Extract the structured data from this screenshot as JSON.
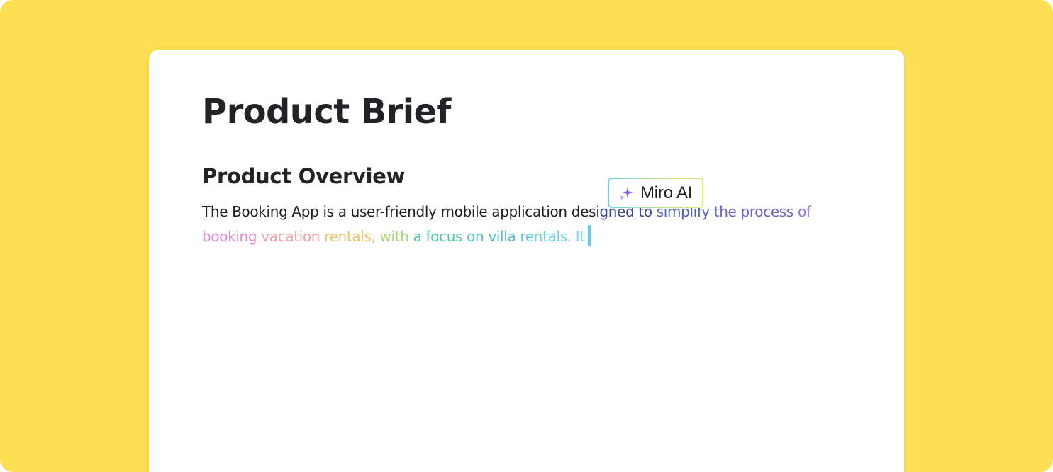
{
  "document": {
    "title": "Product Brief",
    "section_heading": "Product Overview",
    "paragraph_segments": [
      {
        "text": "The Booking App is a user-friendly mobile application des",
        "color": "#1e1f23"
      },
      {
        "text": "igned to ",
        "color": "#3a4a8a"
      },
      {
        "text": "simplify ",
        "color": "#5563b0"
      },
      {
        "text": "the process ",
        "color": "#6a66c8"
      },
      {
        "text": "of ",
        "color": "#8a7be0"
      },
      {
        "text": "booking ",
        "color": "#E08AD6"
      },
      {
        "text": "vacation ",
        "color": "#EFA0A6"
      },
      {
        "text": "rentals, ",
        "color": "#E9C66B"
      },
      {
        "text": "with ",
        "color": "#A6D66F"
      },
      {
        "text": "a focus ",
        "color": "#4FC8A8"
      },
      {
        "text": "on villa ",
        "color": "#4BC3C7"
      },
      {
        "text": "rentals. ",
        "color": "#6ACFDD"
      },
      {
        "text": "It",
        "color": "#86D6E8"
      }
    ]
  },
  "ai_badge": {
    "label": "Miro AI",
    "icon": "sparkle-icon",
    "icon_color": "#8B5CF6"
  },
  "colors": {
    "background": "#FCDF52",
    "card": "#FFFFFF",
    "caret": "#5ED0EE"
  }
}
